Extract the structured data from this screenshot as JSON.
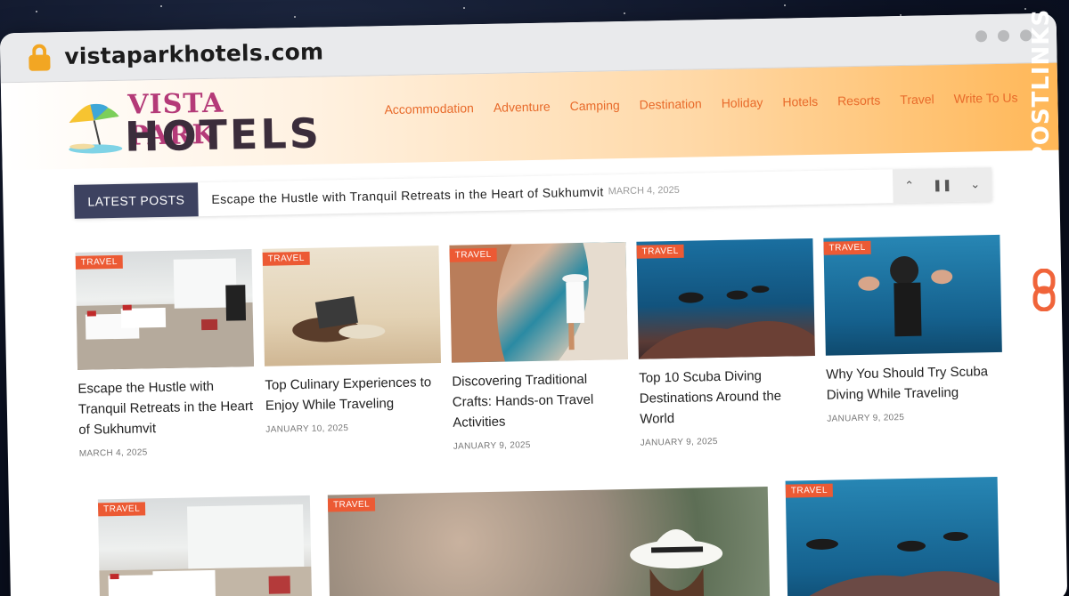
{
  "browser": {
    "url": "vistaparkhotels.com"
  },
  "site": {
    "brand_top": "VISTA PARK",
    "brand_bottom": "HOTELS",
    "nav": [
      "Accommodation",
      "Adventure",
      "Camping",
      "Destination",
      "Holiday",
      "Hotels",
      "Resorts",
      "Travel",
      "Write To Us"
    ]
  },
  "ticker": {
    "label": "LATEST POSTS",
    "headline": "Escape the Hustle with Tranquil Retreats in the Heart of Sukhumvit",
    "date": "MARCH 4, 2025"
  },
  "posts": [
    {
      "badge": "TRAVEL",
      "title": "Escape the Hustle with Tranquil Retreats in the Heart of Sukhumvit",
      "date": "MARCH 4, 2025"
    },
    {
      "badge": "TRAVEL",
      "title": "Top Culinary Experiences to Enjoy While Traveling",
      "date": "JANUARY 10, 2025"
    },
    {
      "badge": "TRAVEL",
      "title": "Discovering Traditional Crafts: Hands-on Travel Activities",
      "date": "JANUARY 9, 2025"
    },
    {
      "badge": "TRAVEL",
      "title": "Top 10 Scuba Diving Destinations Around the World",
      "date": "JANUARY 9, 2025"
    },
    {
      "badge": "TRAVEL",
      "title": "Why You Should Try Scuba Diving While Traveling",
      "date": "JANUARY 9, 2025"
    }
  ],
  "featured": [
    {
      "badge": "TRAVEL"
    },
    {
      "badge": "TRAVEL"
    },
    {
      "badge": "TRAVEL"
    }
  ],
  "watermark": "GUESTPOSTLINKS",
  "colors": {
    "accent": "#ec5a34",
    "nav": "#e86a2a",
    "ticker_label": "#3d4260"
  }
}
